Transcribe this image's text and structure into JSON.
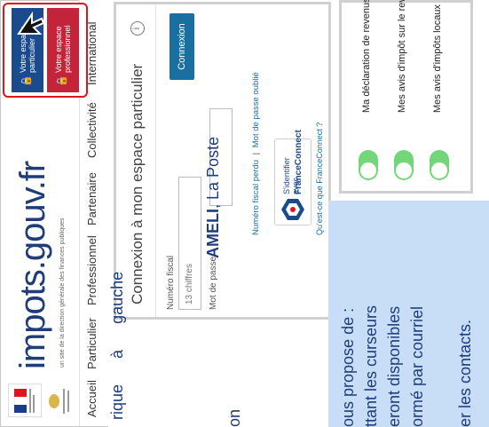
{
  "header": {
    "logo_text": "impots.gouv.fr",
    "tagline": "un site de la direction générale des finances publiques",
    "nav": [
      "Accueil",
      "Particulier",
      "Professionnel",
      "Partenaire",
      "Collectivité",
      "International"
    ],
    "btn_particulier": "Votre espace particulier",
    "btn_professionnel": "Votre espace professionnel"
  },
  "login": {
    "title": "Connexion à mon espace particulier",
    "info_icon": "i",
    "fiscal_label": "Numéro fiscal",
    "fiscal_placeholder": "13 chiffres",
    "password_label": "Mot de passe",
    "connect_button": "Connexion",
    "lost_fiscal": "Numéro fiscal perdu",
    "separator": "|",
    "forgot_password": "Mot de passe oublié",
    "fc_line1": "S'identifier avec",
    "fc_line2": "FranceConnect",
    "fc_question": "Qu'est-ce que FranceConnect ?"
  },
  "settings": {
    "items": [
      {
        "label": "Ma déclaration de revenus",
        "help": "?"
      },
      {
        "label": "Mes avis d'impôt sur le revenu",
        "help": "?"
      },
      {
        "label": "Mes avis d'impôts locaux",
        "help": "?"
      }
    ]
  },
  "doc": {
    "line1a": "rique",
    "line1b": "à",
    "line1c": "gauche",
    "line2a": "AMELI",
    "line2b": ", La Poste",
    "line3": "on",
    "info": [
      "ous propose de :",
      "ttant les curseurs",
      "eront  disponibles",
      "ormé par courriel",
      "",
      "er les contacts."
    ]
  },
  "colors": {
    "accent_red": "#e0141b",
    "pink_button": "#c4243a",
    "blue_button": "#1b4b8f",
    "connexion_blue": "#1a6fa1",
    "toggle_green": "#74d67a",
    "info_bg": "#c7def6",
    "text_blue": "#1f3d7a"
  },
  "icons": {
    "cursor": "cursor-arrow-icon",
    "lock": "lock-icon",
    "info": "info-icon",
    "help": "help-icon"
  }
}
